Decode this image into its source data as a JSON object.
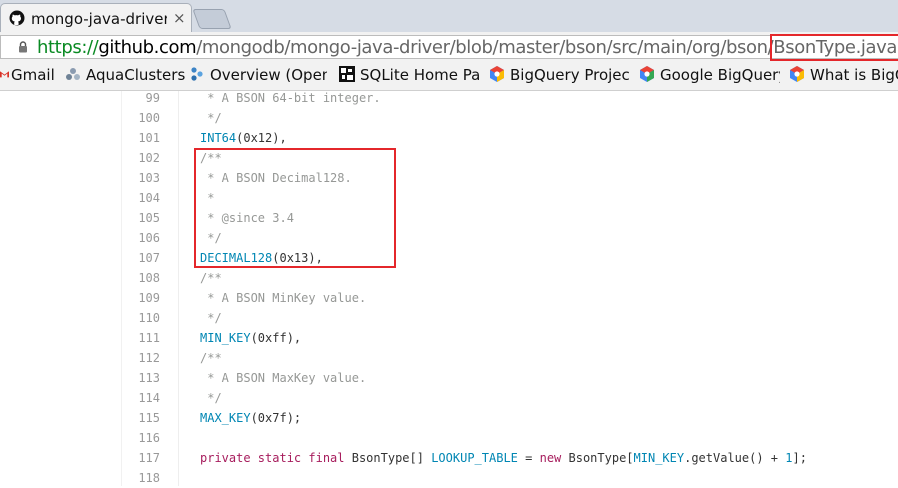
{
  "tab": {
    "title": "mongo-java-driver/B",
    "close": "×"
  },
  "address": {
    "scheme": "https://",
    "host": "github.com",
    "path": "/mongodb/mongo-java-driver/blob/master/bson/src/main/org/bson/",
    "file": "BsonType.java"
  },
  "bookmarks": [
    {
      "label": "Gmail",
      "icon": "gmail-icon"
    },
    {
      "label": "AquaClusters",
      "icon": "aqua-icon"
    },
    {
      "label": "Overview (OpenA",
      "icon": "overview-icon"
    },
    {
      "label": "SQLite Home Pag",
      "icon": "sqlite-icon"
    },
    {
      "label": "BigQuery Project",
      "icon": "bigquery-icon"
    },
    {
      "label": "Google BigQuery",
      "icon": "bigquery-icon"
    },
    {
      "label": "What is BigQ",
      "icon": "bigquery-icon"
    }
  ],
  "code": {
    "lines": [
      {
        "n": "99",
        "parts": [
          [
            "c",
            " * A BSON 64-bit integer."
          ]
        ]
      },
      {
        "n": "100",
        "parts": [
          [
            "c",
            " */"
          ]
        ]
      },
      {
        "n": "101",
        "parts": [
          [
            "e",
            "INT64"
          ],
          [
            "t",
            "(0x12),"
          ]
        ]
      },
      {
        "n": "102",
        "parts": [
          [
            "c",
            "/**"
          ]
        ]
      },
      {
        "n": "103",
        "parts": [
          [
            "c",
            " * A BSON Decimal128."
          ]
        ]
      },
      {
        "n": "104",
        "parts": [
          [
            "c",
            " *"
          ]
        ]
      },
      {
        "n": "105",
        "parts": [
          [
            "c",
            " * @since 3.4"
          ]
        ]
      },
      {
        "n": "106",
        "parts": [
          [
            "c",
            " */"
          ]
        ]
      },
      {
        "n": "107",
        "parts": [
          [
            "e",
            "DECIMAL128"
          ],
          [
            "t",
            "(0x13),"
          ]
        ]
      },
      {
        "n": "108",
        "parts": [
          [
            "c",
            "/**"
          ]
        ]
      },
      {
        "n": "109",
        "parts": [
          [
            "c",
            " * A BSON MinKey value."
          ]
        ]
      },
      {
        "n": "110",
        "parts": [
          [
            "c",
            " */"
          ]
        ]
      },
      {
        "n": "111",
        "parts": [
          [
            "e",
            "MIN_KEY"
          ],
          [
            "t",
            "(0xff),"
          ]
        ]
      },
      {
        "n": "112",
        "parts": [
          [
            "c",
            "/**"
          ]
        ]
      },
      {
        "n": "113",
        "parts": [
          [
            "c",
            " * A BSON MaxKey value."
          ]
        ]
      },
      {
        "n": "114",
        "parts": [
          [
            "c",
            " */"
          ]
        ]
      },
      {
        "n": "115",
        "parts": [
          [
            "e",
            "MAX_KEY"
          ],
          [
            "t",
            "(0x7f);"
          ]
        ]
      },
      {
        "n": "116",
        "parts": []
      },
      {
        "n": "117",
        "parts": [
          [
            "k",
            "private static final "
          ],
          [
            "t",
            "BsonType[] "
          ],
          [
            "e",
            "LOOKUP_TABLE"
          ],
          [
            "t",
            " = "
          ],
          [
            "k",
            "new "
          ],
          [
            "t",
            "BsonType["
          ],
          [
            "e",
            "MIN_KEY"
          ],
          [
            "t",
            ".getValue() + "
          ],
          [
            "e",
            "1"
          ],
          [
            "t",
            "];"
          ]
        ]
      },
      {
        "n": "118",
        "parts": []
      }
    ]
  }
}
